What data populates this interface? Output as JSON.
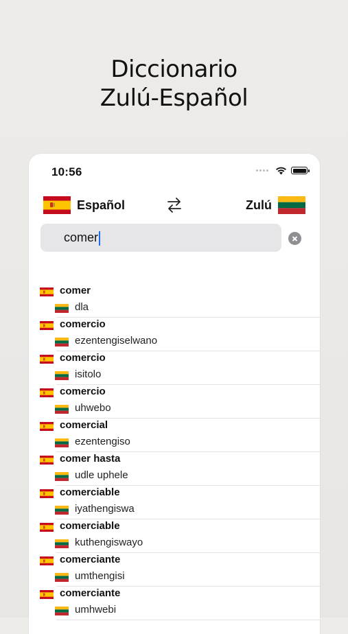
{
  "promo": {
    "title_line1": "Diccionario",
    "title_line2": "Zulú-Español"
  },
  "status": {
    "time": "10:56"
  },
  "languages": {
    "source": "Español",
    "target": "Zulú"
  },
  "search": {
    "value": "comer",
    "placeholder": ""
  },
  "results": [
    {
      "src": "comer",
      "dst": "dla"
    },
    {
      "src": "comercio",
      "dst": "ezentengiselwano"
    },
    {
      "src": "comercio",
      "dst": "isitolo"
    },
    {
      "src": "comercio",
      "dst": "uhwebo"
    },
    {
      "src": "comercial",
      "dst": "ezentengiso"
    },
    {
      "src": "comer hasta",
      "dst": "udle uphele"
    },
    {
      "src": "comerciable",
      "dst": "iyathengiswa"
    },
    {
      "src": "comerciable",
      "dst": "kuthengiswayo"
    },
    {
      "src": "comerciante",
      "dst": "umthengisi"
    },
    {
      "src": "comerciante",
      "dst": "umhwebi"
    }
  ],
  "icons": {
    "source_flag": "spain-flag-icon",
    "target_flag": "zulu-flag-icon",
    "swap": "swap-arrows-icon",
    "clear": "clear-icon",
    "wifi": "wifi-icon",
    "battery": "battery-icon"
  },
  "colors": {
    "flag_es_red": "#c60b1e",
    "flag_es_yellow": "#ffc400",
    "flag_zu_yellow": "#fdb913",
    "flag_zu_green": "#006a44",
    "flag_zu_red": "#c1272d",
    "caret": "#1b6cf2"
  }
}
